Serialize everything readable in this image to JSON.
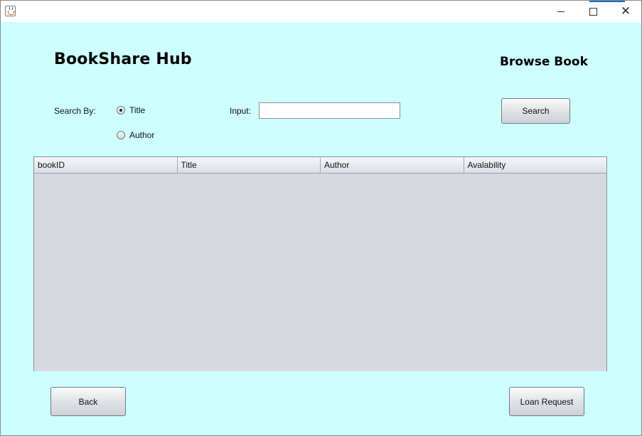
{
  "window": {
    "controls": {
      "minimize": "minimize",
      "maximize": "maximize",
      "close": "close"
    }
  },
  "header": {
    "app_title": "BookShare Hub",
    "page_title": "Browse Book"
  },
  "search": {
    "search_by_label": "Search By:",
    "options": [
      {
        "label": "Title",
        "selected": true
      },
      {
        "label": "Author",
        "selected": false
      }
    ],
    "input_label": "Input:",
    "input_value": "",
    "button_label": "Search"
  },
  "table": {
    "columns": [
      "bookID",
      "Title",
      "Author",
      "Avalability"
    ],
    "rows": []
  },
  "footer": {
    "back_label": "Back",
    "loan_label": "Loan Request"
  },
  "colors": {
    "background": "#ccfffe",
    "table_body": "#d6d9e0"
  },
  "icons": [
    "java-app-icon",
    "minimize-icon",
    "maximize-icon",
    "close-icon"
  ]
}
